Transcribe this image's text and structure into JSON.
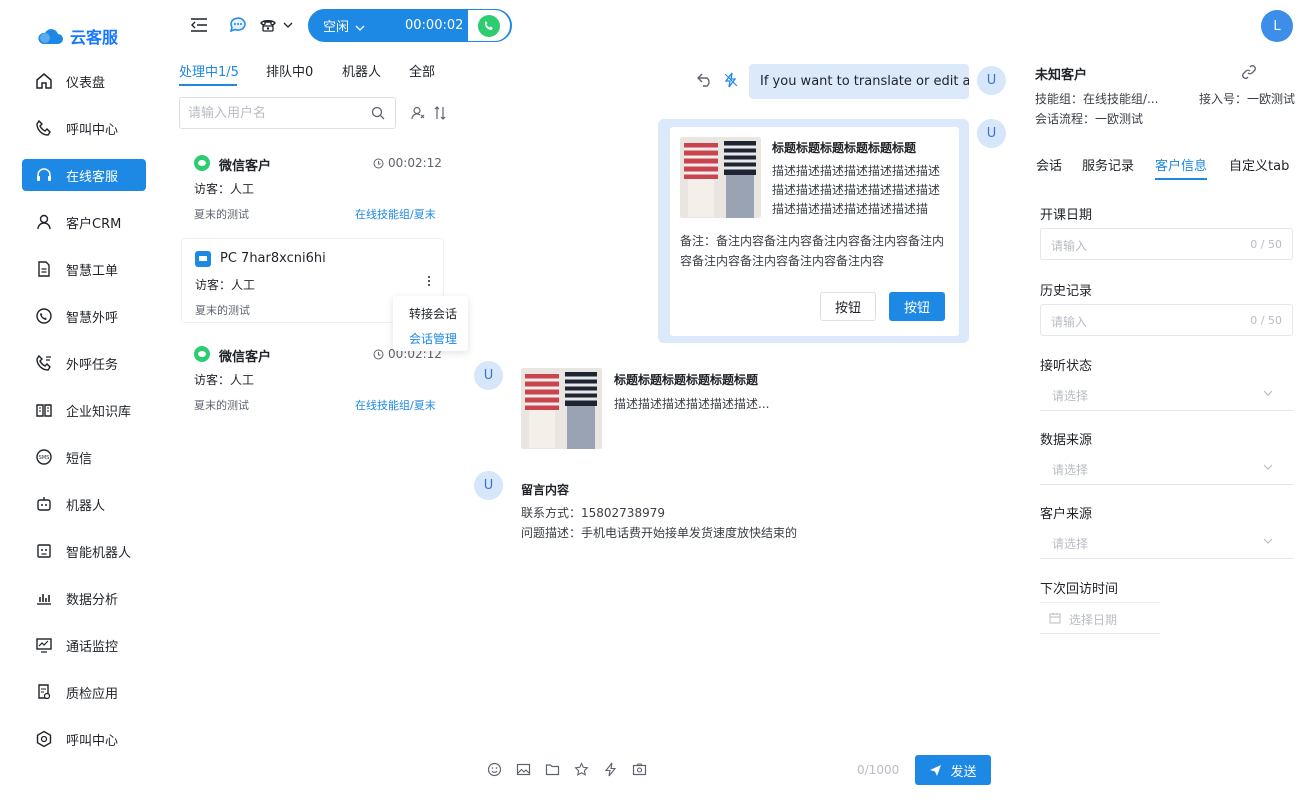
{
  "app": {
    "name": "云客服",
    "brand_color": "#1e88e5"
  },
  "sidebar": {
    "items": [
      {
        "label": "仪表盘",
        "icon": "home-icon"
      },
      {
        "label": "呼叫中心",
        "icon": "phone-icon"
      },
      {
        "label": "在线客服",
        "icon": "headset-icon",
        "active": true
      },
      {
        "label": "客户CRM",
        "icon": "user-icon"
      },
      {
        "label": "智慧工单",
        "icon": "document-icon"
      },
      {
        "label": "智慧外呼",
        "icon": "whatsapp-phone-icon"
      },
      {
        "label": "外呼任务",
        "icon": "phone-task-icon"
      },
      {
        "label": "企业知识库",
        "icon": "book-icon"
      },
      {
        "label": "短信",
        "icon": "sms-icon"
      },
      {
        "label": "机器人",
        "icon": "robot-icon"
      },
      {
        "label": "智能机器人",
        "icon": "smart-robot-icon"
      },
      {
        "label": "数据分析",
        "icon": "bar-chart-icon"
      },
      {
        "label": "通话监控",
        "icon": "monitor-icon"
      },
      {
        "label": "质检应用",
        "icon": "quality-check-icon"
      },
      {
        "label": "呼叫中心",
        "icon": "hexagon-icon"
      }
    ]
  },
  "topbar": {
    "status": "空闲",
    "timer": "00:00:02",
    "user_initial": "L"
  },
  "session_list": {
    "tabs": [
      "处理中1/5",
      "排队中0",
      "机器人",
      "全部"
    ],
    "search_placeholder": "请输入用户名",
    "conversations": [
      {
        "channel": "wechat",
        "name": "微信客户",
        "time": "00:02:12",
        "visitor": "访客：人工",
        "summary": "夏末的测试",
        "group": "在线技能组/夏末"
      },
      {
        "channel": "pc",
        "name": "PC 7har8xcni6hi",
        "time": "",
        "visitor": "访客：人工",
        "summary": "夏末的测试",
        "group": ""
      },
      {
        "channel": "wechat",
        "name": "微信客户",
        "time": "00:02:12",
        "visitor": "访客：人工",
        "summary": "夏末的测试",
        "group": "在线技能组/夏末"
      }
    ],
    "context_menu": [
      "转接会话",
      "会话管理"
    ]
  },
  "chat": {
    "avatar_letter": "U",
    "translate_bubble": "If you want to translate or edit all",
    "card": {
      "title": "标题标题标题标题标题标题",
      "desc": "描述描述描述描述描述描述描述描述描述描述描述描述描述描述描述描述描述描述描述描述描述...",
      "note": "备注：备注内容备注内容备注内容备注内容备注内容备注内容备注内容备注内容备注内容",
      "btn1": "按钮",
      "btn2": "按钮"
    },
    "product": {
      "title": "标题标题标题标题标题标题",
      "desc": "描述描述描述描述描述描述..."
    },
    "leave_msg": {
      "title": "留言内容",
      "contact": "联系方式：15802738979",
      "problem": "问题描述：手机电话费开始接单发货速度放快结束的"
    },
    "input_count": "0/1000",
    "send_label": "发送"
  },
  "customer_panel": {
    "title": "未知客户",
    "skill_group": "技能组：在线技能组/...",
    "access_no": "接入号：一欧测试",
    "flow": "会话流程：一欧测试",
    "tabs": [
      "会话",
      "服务记录",
      "客户信息",
      "自定义tab"
    ],
    "active_tab": 2,
    "fields": {
      "start_date": {
        "label": "开课日期",
        "placeholder": "请输入",
        "count": "0 / 50"
      },
      "history": {
        "label": "历史记录",
        "placeholder": "请输入",
        "count": "0 / 50"
      },
      "answer_status": {
        "label": "接听状态",
        "placeholder": "请选择"
      },
      "data_source": {
        "label": "数据来源",
        "placeholder": "请选择"
      },
      "customer_source": {
        "label": "客户来源",
        "placeholder": "请选择"
      },
      "next_visit": {
        "label": "下次回访时间",
        "placeholder": "选择日期"
      }
    }
  }
}
